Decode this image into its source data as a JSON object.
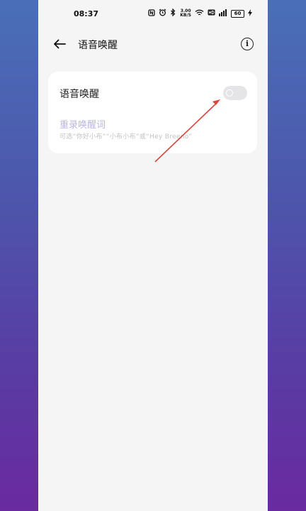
{
  "status_bar": {
    "time": "08:37",
    "net_speed_value": "3.00",
    "net_speed_unit": "KB/S",
    "battery": "60",
    "icons": [
      "nfc-icon",
      "alarm-icon",
      "bluetooth-icon",
      "wifi-icon",
      "hd-icon",
      "signal-icon",
      "battery-icon",
      "charging-icon"
    ]
  },
  "header": {
    "title": "语音唤醒"
  },
  "card": {
    "voice_wakeup_label": "语音唤醒",
    "toggle_on": false,
    "rerecord_label": "重录唤醒词",
    "rerecord_subtitle": "可选“你好小布”“小布小布”或“Hey Breeno”"
  },
  "annotation": {
    "color": "#d9463c"
  }
}
